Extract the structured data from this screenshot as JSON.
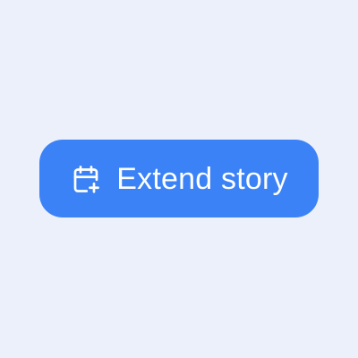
{
  "button": {
    "label": "Extend story",
    "icon": "calendar-plus-icon",
    "background_color": "#3b82f6",
    "text_color": "#ffffff"
  },
  "page": {
    "background_color": "#ecf0fb"
  }
}
